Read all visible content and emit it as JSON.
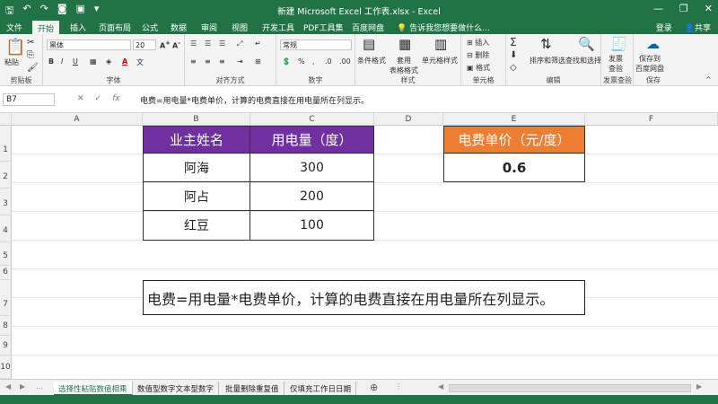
{
  "titlebar": {
    "title": "新建 Microsoft Excel 工作表.xlsx - Excel",
    "qa_icons": [
      "save-icon",
      "undo-icon",
      "redo-icon",
      "camera-icon",
      "screenshot-icon",
      "more-icon"
    ],
    "min": "—",
    "restore": "❐",
    "close": "✕"
  },
  "tabs": {
    "items": [
      "文件",
      "开始",
      "插入",
      "页面布局",
      "公式",
      "数据",
      "审阅",
      "视图",
      "开发工具",
      "PDF工具集",
      "百度网盘"
    ],
    "tell": "告诉我您想要做什么...",
    "login": "登录",
    "share": "共享"
  },
  "ribbon": {
    "paste": "粘贴",
    "clipboard": "剪贴板",
    "font_name": "黑体",
    "font_size": "20",
    "font_group": "字体",
    "align_group": "对齐方式",
    "number_format": "常规",
    "number_group": "数字",
    "cond_format": "条件格式",
    "table_format": "套用\n表格格式",
    "cell_style": "单元格样式",
    "styles_group": "样式",
    "insert": "插入",
    "delete": "删除",
    "format": "格式",
    "cells_group": "单元格",
    "sort_filter": "排序和筛选",
    "find_select": "查找和选择",
    "edit_group": "编辑",
    "invoice_check": "发票\n查验",
    "invoice_group": "发票查验",
    "save_to": "保存到\n百度网盘",
    "save_group": "保存"
  },
  "formula": {
    "namebox": "B7",
    "cancel": "✕",
    "enter": "✓",
    "fx": "fx",
    "content": "电费=用电量*电费单价，计算的电费直接在用电量所在列显示。"
  },
  "columns": [
    "A",
    "B",
    "C",
    "D",
    "E",
    "F"
  ],
  "rows": [
    "1",
    "2",
    "3",
    "4",
    "5",
    "6",
    "7",
    "8",
    "9",
    "10"
  ],
  "table": {
    "headers": [
      "业主姓名",
      "用电量（度）"
    ],
    "rows": [
      [
        "阿海",
        "300"
      ],
      [
        "阿占",
        "200"
      ],
      [
        "红豆",
        "100"
      ]
    ]
  },
  "price": {
    "header": "电费单价（元/度）",
    "value": "0.6"
  },
  "note": "电费=用电量*电费单价，计算的电费直接在用电量所在列显示。",
  "sheets": [
    "选择性粘贴数值相乘",
    "数值型数字文本型数字",
    "批量删除重复值",
    "仅填充工作日日期"
  ],
  "sheet_add": "⊕",
  "colors": {
    "excel_green": "#217346",
    "header_purple": "#7030a0",
    "header_orange": "#ed7d31"
  }
}
